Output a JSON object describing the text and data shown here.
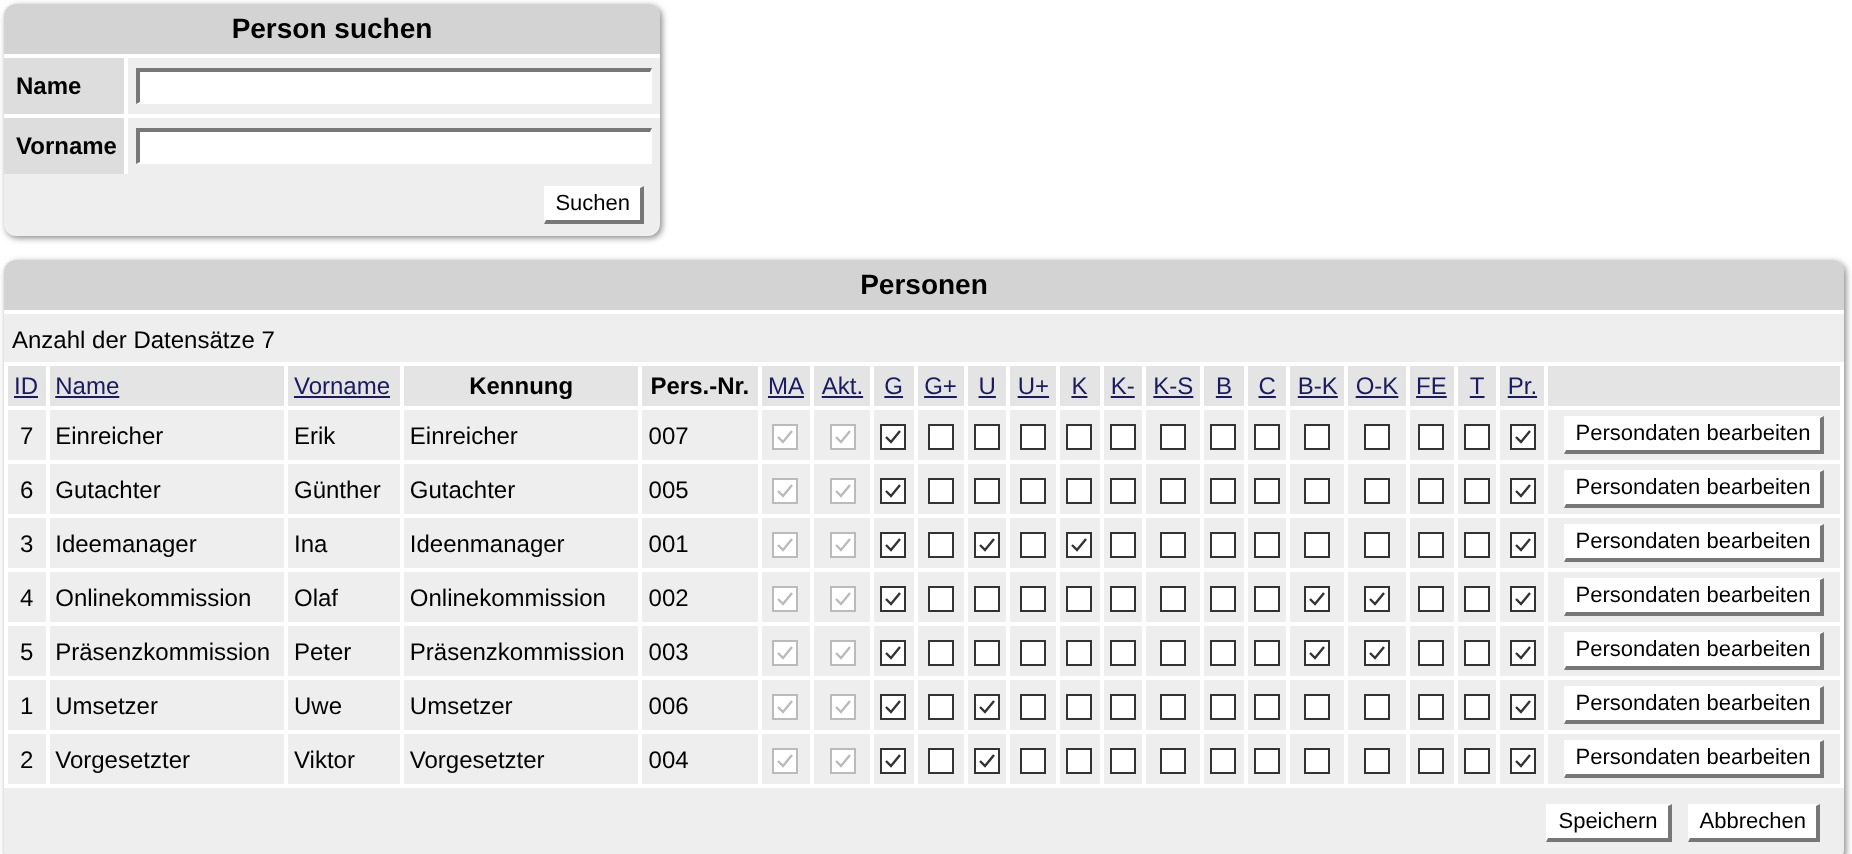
{
  "search": {
    "title": "Person suchen",
    "fields": [
      {
        "label": "Name"
      },
      {
        "label": "Vorname"
      }
    ],
    "button": "Suchen"
  },
  "persons": {
    "title": "Personen",
    "count_label": "Anzahl der Datensätze 7",
    "columns": [
      {
        "label": "ID",
        "kind": "link"
      },
      {
        "label": "Name",
        "kind": "link"
      },
      {
        "label": "Vorname",
        "kind": "link"
      },
      {
        "label": "Kennung",
        "kind": "plain"
      },
      {
        "label": "Pers.-Nr.",
        "kind": "plain"
      },
      {
        "label": "MA",
        "kind": "check",
        "disabled": true
      },
      {
        "label": "Akt.",
        "kind": "check",
        "disabled": true
      },
      {
        "label": "G",
        "kind": "check",
        "disabled": false
      },
      {
        "label": "G+",
        "kind": "check",
        "disabled": false
      },
      {
        "label": "U",
        "kind": "check",
        "disabled": false
      },
      {
        "label": "U+",
        "kind": "check",
        "disabled": false
      },
      {
        "label": "K",
        "kind": "check",
        "disabled": false
      },
      {
        "label": "K-",
        "kind": "check",
        "disabled": false
      },
      {
        "label": "K-S",
        "kind": "check",
        "disabled": false
      },
      {
        "label": "B",
        "kind": "check",
        "disabled": false
      },
      {
        "label": "C",
        "kind": "check",
        "disabled": false
      },
      {
        "label": "B-K",
        "kind": "check",
        "disabled": false
      },
      {
        "label": "O-K",
        "kind": "check",
        "disabled": false
      },
      {
        "label": "FE",
        "kind": "check",
        "disabled": false
      },
      {
        "label": "T",
        "kind": "check",
        "disabled": false
      },
      {
        "label": "Pr.",
        "kind": "check",
        "disabled": false
      }
    ],
    "rows": [
      {
        "id": "7",
        "name": "Einreicher",
        "vorname": "Erik",
        "kennung": "Einreicher",
        "persnr": "007",
        "checks": [
          true,
          true,
          true,
          false,
          false,
          false,
          false,
          false,
          false,
          false,
          false,
          false,
          false,
          false,
          false,
          true
        ],
        "button": "Persondaten bearbeiten"
      },
      {
        "id": "6",
        "name": "Gutachter",
        "vorname": "Günther",
        "kennung": "Gutachter",
        "persnr": "005",
        "checks": [
          true,
          true,
          true,
          false,
          false,
          false,
          false,
          false,
          false,
          false,
          false,
          false,
          false,
          false,
          false,
          true
        ],
        "button": "Persondaten bearbeiten"
      },
      {
        "id": "3",
        "name": "Ideemanager",
        "vorname": "Ina",
        "kennung": "Ideenmanager",
        "persnr": "001",
        "checks": [
          true,
          true,
          true,
          false,
          true,
          false,
          true,
          false,
          false,
          false,
          false,
          false,
          false,
          false,
          false,
          true
        ],
        "button": "Persondaten bearbeiten"
      },
      {
        "id": "4",
        "name": "Onlinekommission",
        "vorname": "Olaf",
        "kennung": "Onlinekommission",
        "persnr": "002",
        "checks": [
          true,
          true,
          true,
          false,
          false,
          false,
          false,
          false,
          false,
          false,
          false,
          true,
          true,
          false,
          false,
          true
        ],
        "button": "Persondaten bearbeiten"
      },
      {
        "id": "5",
        "name": "Präsenzkommission",
        "vorname": "Peter",
        "kennung": "Präsenzkommission",
        "persnr": "003",
        "checks": [
          true,
          true,
          true,
          false,
          false,
          false,
          false,
          false,
          false,
          false,
          false,
          true,
          true,
          false,
          false,
          true
        ],
        "button": "Persondaten bearbeiten"
      },
      {
        "id": "1",
        "name": "Umsetzer",
        "vorname": "Uwe",
        "kennung": "Umsetzer",
        "persnr": "006",
        "checks": [
          true,
          true,
          true,
          false,
          true,
          false,
          false,
          false,
          false,
          false,
          false,
          false,
          false,
          false,
          false,
          true
        ],
        "button": "Persondaten bearbeiten"
      },
      {
        "id": "2",
        "name": "Vorgesetzter",
        "vorname": "Viktor",
        "kennung": "Vorgesetzter",
        "persnr": "004",
        "checks": [
          true,
          true,
          true,
          false,
          true,
          false,
          false,
          false,
          false,
          false,
          false,
          false,
          false,
          false,
          false,
          true
        ],
        "button": "Persondaten bearbeiten"
      }
    ],
    "buttons": [
      "Speichern",
      "Abbrechen"
    ]
  }
}
